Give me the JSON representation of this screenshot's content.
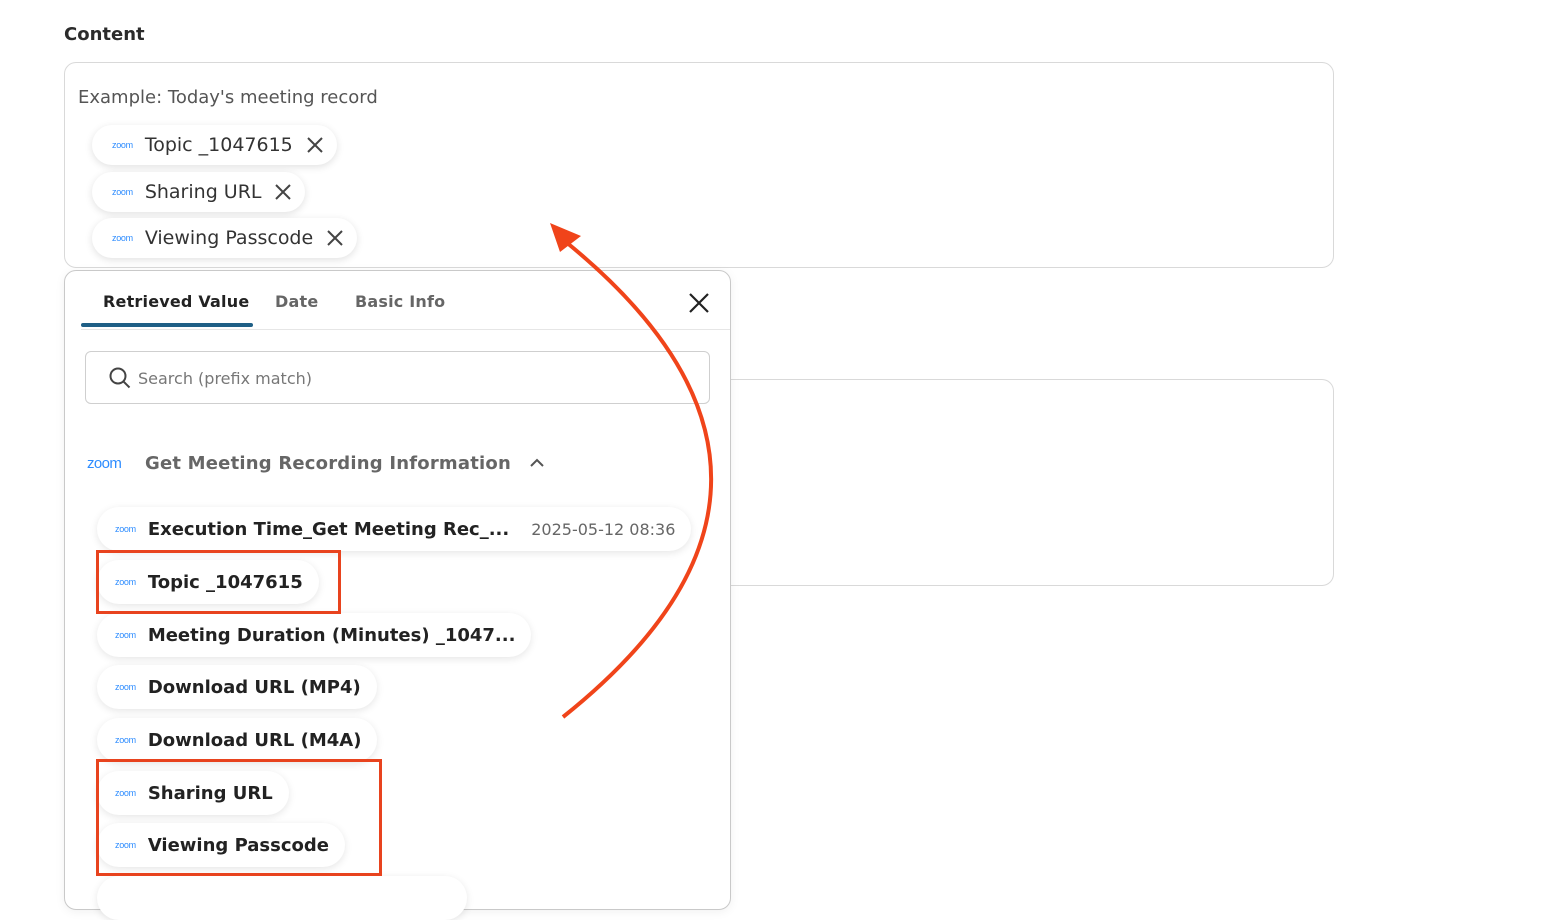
{
  "content_section": {
    "label": "Content",
    "example_text": "Example: Today's meeting record",
    "chips": [
      {
        "icon": "zoom-logo-icon",
        "brand": "zoom",
        "label": "Topic _1047615"
      },
      {
        "icon": "zoom-logo-icon",
        "brand": "zoom",
        "label": "Sharing URL"
      },
      {
        "icon": "zoom-logo-icon",
        "brand": "zoom",
        "label": "Viewing Passcode"
      }
    ]
  },
  "panel": {
    "tabs": [
      {
        "label": "Retrieved Value",
        "active": true
      },
      {
        "label": "Date",
        "active": false
      },
      {
        "label": "Basic Info",
        "active": false
      }
    ],
    "search": {
      "placeholder": "Search (prefix match)",
      "value": ""
    },
    "group": {
      "brand": "zoom",
      "title": "Get Meeting Recording Information",
      "expanded": true
    },
    "items": [
      {
        "brand": "zoom",
        "label": "Execution Time_Get Meeting Rec_...",
        "value": "2025-05-12 08:36",
        "highlighted": false
      },
      {
        "brand": "zoom",
        "label": "Topic _1047615",
        "value": "",
        "highlighted": true
      },
      {
        "brand": "zoom",
        "label": "Meeting Duration (Minutes) _1047...",
        "value": "",
        "highlighted": false
      },
      {
        "brand": "zoom",
        "label": "Download URL (MP4)",
        "value": "",
        "highlighted": false
      },
      {
        "brand": "zoom",
        "label": "Download URL (M4A)",
        "value": "",
        "highlighted": false
      },
      {
        "brand": "zoom",
        "label": "Sharing URL",
        "value": "",
        "highlighted": true
      },
      {
        "brand": "zoom",
        "label": "Viewing Passcode",
        "value": "",
        "highlighted": true
      }
    ]
  },
  "colors": {
    "accent_tab": "#1f5f86",
    "zoom_blue": "#2d8cff",
    "highlight_red": "#e8431e"
  }
}
